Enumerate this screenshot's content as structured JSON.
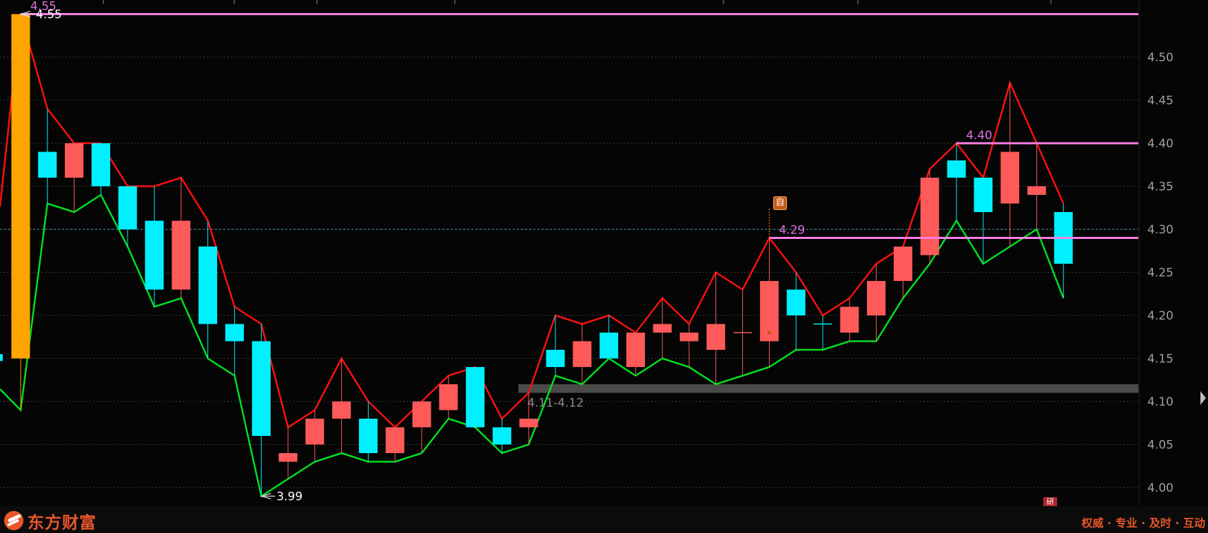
{
  "chart_data": {
    "type": "candlestick",
    "y_axis": {
      "ticks": [
        "4.50",
        "4.45",
        "4.40",
        "4.35",
        "4.30",
        "4.25",
        "4.20",
        "4.15",
        "4.10",
        "4.05",
        "4.00"
      ],
      "ylim": [
        3.985,
        4.565
      ]
    },
    "candles": [
      {
        "o": 4.15,
        "c": 4.55,
        "h": 4.55,
        "l": 4.09,
        "up": true,
        "highlight": true
      },
      {
        "o": 4.39,
        "c": 4.36,
        "h": 4.44,
        "l": 4.33,
        "up": false
      },
      {
        "o": 4.36,
        "c": 4.4,
        "h": 4.4,
        "l": 4.32,
        "up": true
      },
      {
        "o": 4.4,
        "c": 4.35,
        "h": 4.4,
        "l": 4.34,
        "up": false
      },
      {
        "o": 4.35,
        "c": 4.3,
        "h": 4.35,
        "l": 4.28,
        "up": false
      },
      {
        "o": 4.31,
        "c": 4.23,
        "h": 4.35,
        "l": 4.21,
        "up": false
      },
      {
        "o": 4.23,
        "c": 4.31,
        "h": 4.36,
        "l": 4.22,
        "up": true
      },
      {
        "o": 4.28,
        "c": 4.19,
        "h": 4.31,
        "l": 4.15,
        "up": false
      },
      {
        "o": 4.19,
        "c": 4.17,
        "h": 4.21,
        "l": 4.13,
        "up": false
      },
      {
        "o": 4.17,
        "c": 4.06,
        "h": 4.19,
        "l": 3.99,
        "up": false
      },
      {
        "o": 4.03,
        "c": 4.04,
        "h": 4.07,
        "l": 4.01,
        "up": true
      },
      {
        "o": 4.05,
        "c": 4.08,
        "h": 4.09,
        "l": 4.03,
        "up": true
      },
      {
        "o": 4.08,
        "c": 4.1,
        "h": 4.15,
        "l": 4.04,
        "up": true
      },
      {
        "o": 4.08,
        "c": 4.04,
        "h": 4.1,
        "l": 4.03,
        "up": false
      },
      {
        "o": 4.04,
        "c": 4.07,
        "h": 4.07,
        "l": 4.03,
        "up": true
      },
      {
        "o": 4.07,
        "c": 4.1,
        "h": 4.1,
        "l": 4.04,
        "up": true
      },
      {
        "o": 4.09,
        "c": 4.12,
        "h": 4.13,
        "l": 4.08,
        "up": true
      },
      {
        "o": 4.14,
        "c": 4.07,
        "h": 4.14,
        "l": 4.07,
        "up": false
      },
      {
        "o": 4.07,
        "c": 4.05,
        "h": 4.08,
        "l": 4.04,
        "up": false
      },
      {
        "o": 4.07,
        "c": 4.08,
        "h": 4.11,
        "l": 4.05,
        "up": true
      },
      {
        "o": 4.16,
        "c": 4.14,
        "h": 4.2,
        "l": 4.13,
        "up": false
      },
      {
        "o": 4.14,
        "c": 4.17,
        "h": 4.19,
        "l": 4.12,
        "up": true
      },
      {
        "o": 4.18,
        "c": 4.15,
        "h": 4.2,
        "l": 4.15,
        "up": false
      },
      {
        "o": 4.14,
        "c": 4.18,
        "h": 4.18,
        "l": 4.13,
        "up": true
      },
      {
        "o": 4.18,
        "c": 4.19,
        "h": 4.22,
        "l": 4.15,
        "up": true
      },
      {
        "o": 4.17,
        "c": 4.18,
        "h": 4.19,
        "l": 4.14,
        "up": true
      },
      {
        "o": 4.16,
        "c": 4.19,
        "h": 4.25,
        "l": 4.12,
        "up": true
      },
      {
        "o": 4.18,
        "c": 4.18,
        "h": 4.23,
        "l": 4.13,
        "up": true,
        "doji": true
      },
      {
        "o": 4.17,
        "c": 4.24,
        "h": 4.29,
        "l": 4.14,
        "up": true
      },
      {
        "o": 4.23,
        "c": 4.2,
        "h": 4.25,
        "l": 4.16,
        "up": false
      },
      {
        "o": 4.19,
        "c": 4.19,
        "h": 4.2,
        "l": 4.16,
        "up": false,
        "doji": true
      },
      {
        "o": 4.18,
        "c": 4.21,
        "h": 4.22,
        "l": 4.17,
        "up": true
      },
      {
        "o": 4.2,
        "c": 4.24,
        "h": 4.26,
        "l": 4.17,
        "up": true
      },
      {
        "o": 4.24,
        "c": 4.28,
        "h": 4.28,
        "l": 4.22,
        "up": true
      },
      {
        "o": 4.27,
        "c": 4.36,
        "h": 4.37,
        "l": 4.26,
        "up": true
      },
      {
        "o": 4.38,
        "c": 4.36,
        "h": 4.4,
        "l": 4.31,
        "up": false
      },
      {
        "o": 4.36,
        "c": 4.32,
        "h": 4.36,
        "l": 4.26,
        "up": false
      },
      {
        "o": 4.33,
        "c": 4.39,
        "h": 4.47,
        "l": 4.28,
        "up": true
      },
      {
        "o": 4.35,
        "c": 4.34,
        "h": 4.4,
        "l": 4.3,
        "up": true
      },
      {
        "o": 4.32,
        "c": 4.26,
        "h": 4.33,
        "l": 4.22,
        "up": false
      }
    ],
    "reference_lines": [
      {
        "value": 4.55,
        "label": "4.55",
        "color": "#ff7ee6"
      },
      {
        "value": 4.4,
        "label": "4.40",
        "color": "#ff7ee6",
        "from_index": 35
      },
      {
        "value": 4.29,
        "label": "4.29",
        "color": "#ff7ee6",
        "from_index": 28
      }
    ],
    "dashed_price": 4.3,
    "band": {
      "from": 4.11,
      "to": 4.12,
      "label": "4.11-4.12",
      "from_index": 19
    },
    "annotations": [
      {
        "label": "4.55",
        "index": 0
      },
      {
        "label": "3.99",
        "index": 9
      }
    ],
    "colors": {
      "up": "#ff5a5a",
      "down": "#00f0ff",
      "high_line": "#ff1010",
      "low_line": "#00e020",
      "highlight": "#ffa500",
      "ref_label": "#e070e0",
      "grid": "#3a3a3a",
      "axis_text": "#a0a0a0"
    }
  },
  "markers": {
    "zi": "自",
    "bottom": "研"
  },
  "footer": {
    "brand": "东方财富",
    "slogan": "权威 · 专业 · 及时 · 互动"
  }
}
